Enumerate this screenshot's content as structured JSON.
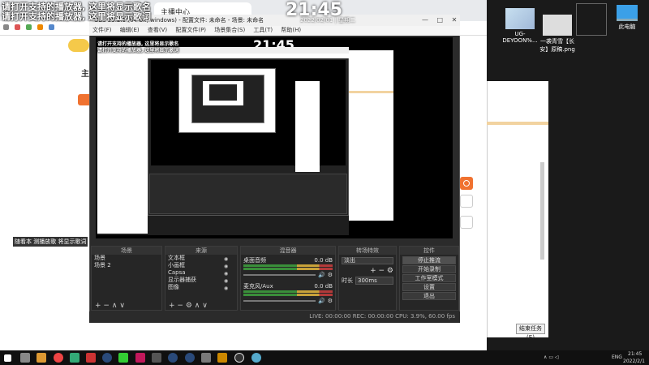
{
  "lyric_overlay": {
    "line1": "请打开支持的播放器, 这里将显示歌名",
    "line2": "请打开支持的播放器, 这里将显示歌词"
  },
  "browser": {
    "tab_title": "主播中心",
    "site_label": "主",
    "left_caption": "随看本 测播放歌 将显示歌词"
  },
  "obs": {
    "title": "OBS 23.2.1 (64-bit, windows) - 配置文件: 未命名 - 场景: 未命名",
    "menu": [
      "文件(F)",
      "编辑(E)",
      "查看(V)",
      "配置文件(P)",
      "场景集合(S)",
      "工具(T)",
      "帮助(H)"
    ],
    "clock": "21:45",
    "date": "2022/02/01 | 星期二",
    "docks": {
      "scenes": {
        "title": "场景",
        "items": [
          "场景",
          "场景 2"
        ]
      },
      "sources": {
        "title": "来源",
        "items": [
          "文本框",
          "小画框",
          "Capsa",
          "显示器捕获",
          "图像"
        ]
      },
      "mixer": {
        "title": "混音器",
        "tracks": [
          {
            "name": "桌面音频",
            "db": "0.0 dB"
          },
          {
            "name": "麦克风/Aux",
            "db": "0.0 dB"
          }
        ]
      },
      "transitions": {
        "title": "转场特效",
        "type": "淡出",
        "duration_label": "时长",
        "duration": "300ms"
      },
      "controls": {
        "title": "控件",
        "buttons": [
          "停止推流",
          "开始录制",
          "工作室模式",
          "设置",
          "退出"
        ]
      }
    },
    "status": "LIVE: 00:00:00   REC: 00:00:00   CPU: 3.9%, 60.00 fps"
  },
  "desktop": {
    "big_clock": "21:45",
    "icons": [
      {
        "label": "UG-DEYOON%..."
      },
      {
        "label": "一袭青雪【长安】原稿.png"
      },
      {
        "label": ""
      },
      {
        "label": "此电脑"
      }
    ]
  },
  "right_app": {
    "footer_button": "结束任务(E)"
  },
  "taskbar": {
    "time": "21:45",
    "date": "2022/2/1",
    "lang": "ENG"
  },
  "colors": {
    "obs_bg": "#2b2b2b",
    "accent_orange": "#f07230",
    "desktop": "#1a1a1a"
  }
}
